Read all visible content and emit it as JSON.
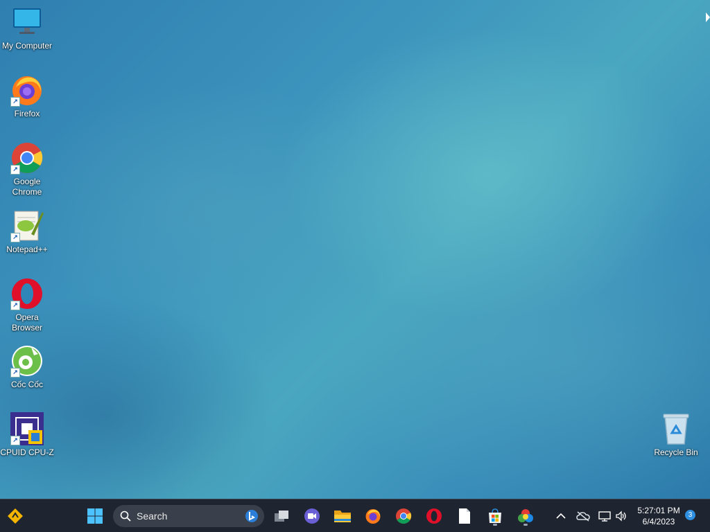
{
  "desktop": {
    "icons": [
      {
        "name": "my-computer",
        "label": "My Computer",
        "icon": "monitor-icon"
      },
      {
        "name": "firefox",
        "label": "Firefox",
        "icon": "firefox-icon"
      },
      {
        "name": "google-chrome",
        "label": "Google Chrome",
        "icon": "chrome-icon"
      },
      {
        "name": "notepad-plus-plus",
        "label": "Notepad++",
        "icon": "notepad-plus-plus-icon"
      },
      {
        "name": "opera-browser",
        "label": "Opera Browser",
        "icon": "opera-icon"
      },
      {
        "name": "coc-coc",
        "label": "Cốc Cốc",
        "icon": "coc-coc-icon"
      },
      {
        "name": "cpuid-cpu-z",
        "label": "CPUID CPU-Z",
        "icon": "cpu-z-icon"
      },
      {
        "name": "recycle-bin",
        "label": "Recycle Bin",
        "icon": "recycle-bin-icon"
      }
    ]
  },
  "taskbar": {
    "search_placeholder": "Search",
    "apps": [
      "start-icon",
      "task-view-icon",
      "meet-chat-icon",
      "file-explorer-icon",
      "firefox-icon",
      "chrome-icon",
      "opera-icon",
      "notepad-icon",
      "microsoft-store-icon",
      "photos-icon"
    ],
    "tray": [
      "chevron-up-icon",
      "onedrive-offline-icon",
      "network-icon",
      "volume-icon"
    ],
    "clock": {
      "time": "5:27:01 PM",
      "date": "6/4/2023"
    },
    "notification_count": "3"
  },
  "colors": {
    "taskbar_bg": "#1f2530",
    "accent": "#2f8fe0"
  }
}
